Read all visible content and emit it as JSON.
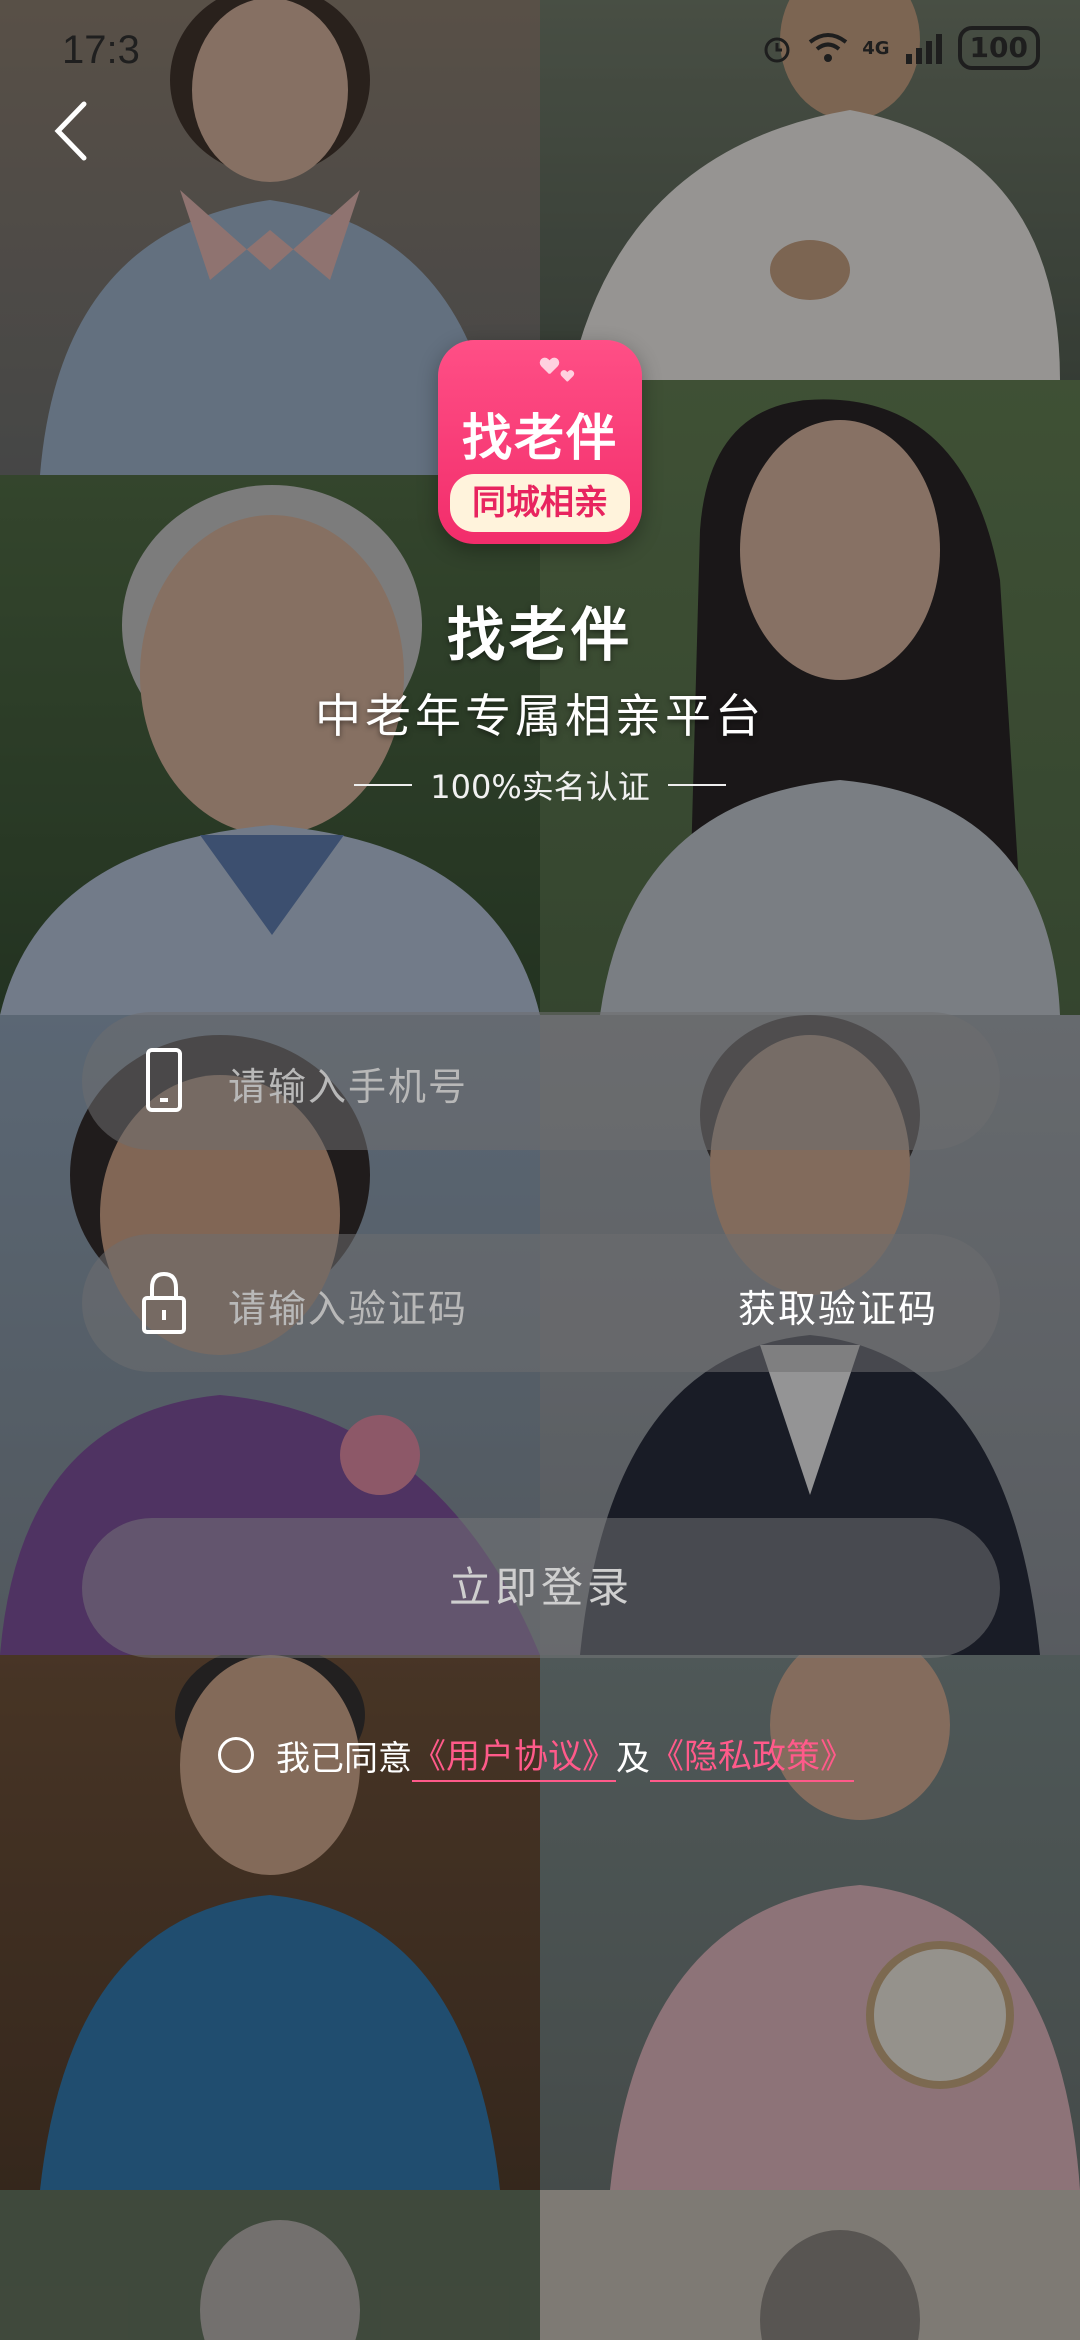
{
  "status_bar": {
    "time": "17:3",
    "network": "4G",
    "battery": "100"
  },
  "app_badge": {
    "title": "找老伴",
    "subtitle": "同城相亲"
  },
  "hero": {
    "title": "找老伴",
    "subtitle": "中老年专属相亲平台",
    "tagline": "100%实名认证"
  },
  "form": {
    "phone_placeholder": "请输入手机号",
    "code_placeholder": "请输入验证码",
    "get_code_label": "获取验证码",
    "login_label": "立即登录"
  },
  "agreement": {
    "prefix": "我已同意",
    "user_agreement": "《用户协议》",
    "conjunction": "及",
    "privacy_policy": "《隐私政策》"
  },
  "colors": {
    "brand_pink": "#f22d6b",
    "link_pink": "#ff5a8a"
  },
  "icons": [
    "back-arrow-icon",
    "phone-icon",
    "lock-icon",
    "wifi-icon",
    "signal-icon",
    "battery-icon",
    "alarm-icon"
  ]
}
